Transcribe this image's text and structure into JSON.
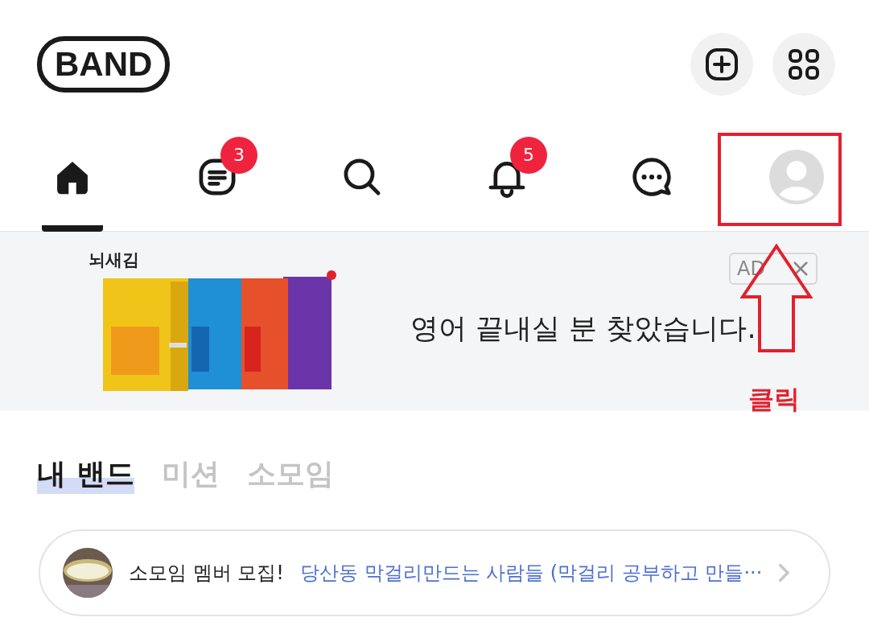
{
  "header": {
    "logo": "BAND"
  },
  "nav_tabs": [
    {
      "kind": "home",
      "selected": true
    },
    {
      "kind": "feed",
      "selected": false,
      "badge": "3"
    },
    {
      "kind": "search",
      "selected": false
    },
    {
      "kind": "bell",
      "selected": false,
      "badge": "5"
    },
    {
      "kind": "chat",
      "selected": false
    },
    {
      "kind": "profile",
      "selected": false
    }
  ],
  "ad": {
    "brand": "뇌새김",
    "headline": "영어 끝내실 분 찾았습니다.",
    "ad_label": "AD"
  },
  "annotation": {
    "label": "클릭"
  },
  "segments": [
    {
      "label": "내 밴드",
      "selected": true
    },
    {
      "label": "미션",
      "selected": false
    },
    {
      "label": "소모임",
      "selected": false
    }
  ],
  "notice": {
    "prefix": "소모임 멤버 모집!",
    "link": "당산동 막걸리만드는 사람들 (막걸리 공부하고 만들···"
  }
}
